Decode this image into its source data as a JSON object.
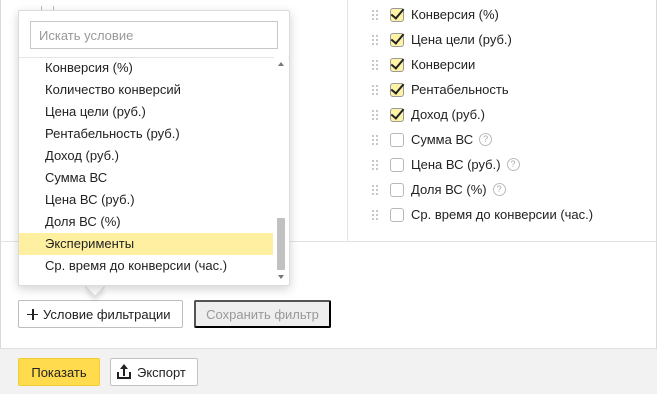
{
  "metrics": [
    {
      "label": "Конверсия (%)",
      "checked": true,
      "help": false
    },
    {
      "label": "Цена цели (руб.)",
      "checked": true,
      "help": false
    },
    {
      "label": "Конверсии",
      "checked": true,
      "help": false
    },
    {
      "label": "Рентабельность",
      "checked": true,
      "help": false
    },
    {
      "label": "Доход (руб.)",
      "checked": true,
      "help": false
    },
    {
      "label": "Сумма ВС",
      "checked": false,
      "help": true
    },
    {
      "label": "Цена ВС (руб.)",
      "checked": false,
      "help": true
    },
    {
      "label": "Доля ВС (%)",
      "checked": false,
      "help": true
    },
    {
      "label": "Ср. время до конверсии (час.)",
      "checked": false,
      "help": false
    }
  ],
  "help_glyph": "?",
  "dropdown": {
    "search_placeholder": "Искать условие",
    "search_value": "",
    "options": [
      {
        "label": "Конверсия (%)",
        "highlighted": false
      },
      {
        "label": "Количество конверсий",
        "highlighted": false
      },
      {
        "label": "Цена цели (руб.)",
        "highlighted": false
      },
      {
        "label": "Рентабельность (руб.)",
        "highlighted": false
      },
      {
        "label": "Доход (руб.)",
        "highlighted": false
      },
      {
        "label": "Сумма ВС",
        "highlighted": false
      },
      {
        "label": "Цена ВС (руб.)",
        "highlighted": false
      },
      {
        "label": "Доля ВС (%)",
        "highlighted": false
      },
      {
        "label": "Эксперименты",
        "highlighted": true
      },
      {
        "label": "Ср. время до конверсии (час.)",
        "highlighted": false
      }
    ]
  },
  "filter": {
    "add_label": "Условие фильтрации",
    "save_label": "Сохранить фильтр"
  },
  "footer": {
    "show_label": "Показать",
    "export_label": "Экспорт"
  },
  "colors": {
    "accent_yellow": "#ffdb4d",
    "highlight_yellow": "#fff0a1",
    "footer_bg": "#f2f2f2"
  }
}
